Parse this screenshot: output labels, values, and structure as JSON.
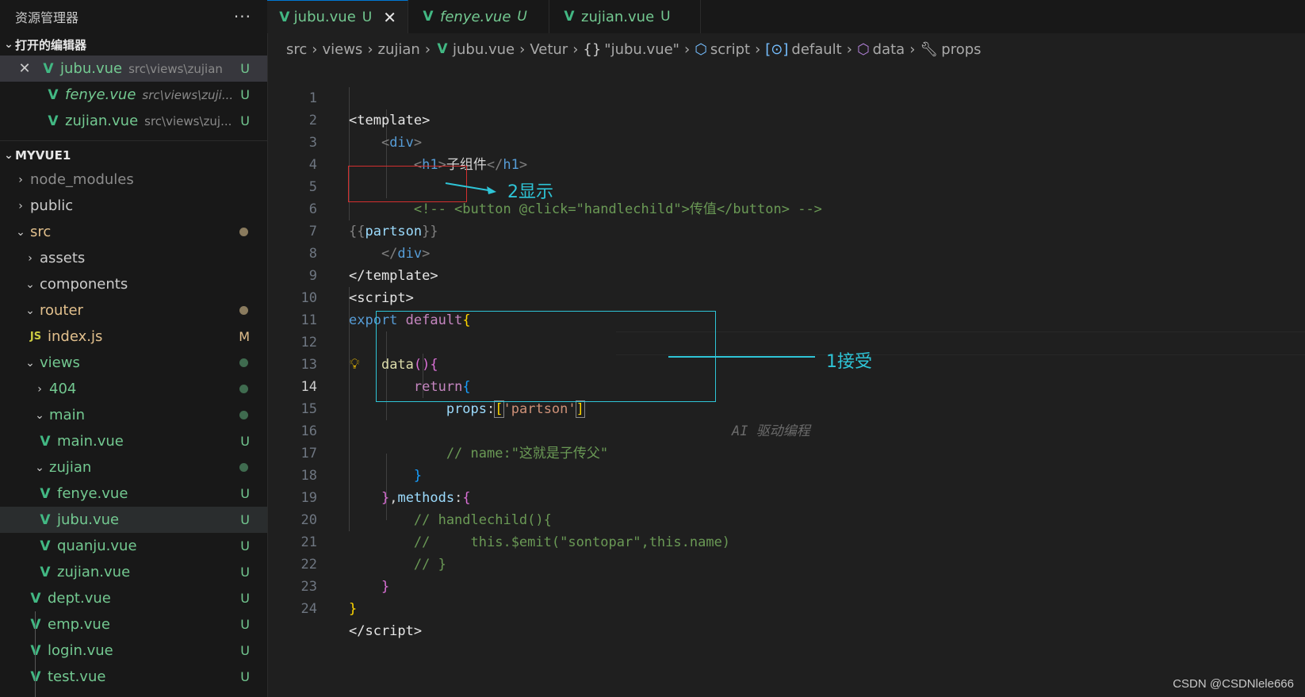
{
  "explorer": {
    "title": "资源管理器",
    "more": "···",
    "open_editors": {
      "title": "打开的编辑器",
      "items": [
        {
          "name": "jubu.vue",
          "path": "src\\views\\zujian",
          "status": "U"
        },
        {
          "name": "fenye.vue",
          "path": "src\\views\\zuji...",
          "status": "U"
        },
        {
          "name": "zujian.vue",
          "path": "src\\views\\zuj...",
          "status": "U"
        }
      ]
    },
    "project": {
      "title": "MYVUE1",
      "tree": [
        {
          "label": "node_modules"
        },
        {
          "label": "public"
        },
        {
          "label": "src"
        },
        {
          "label": "assets"
        },
        {
          "label": "components"
        },
        {
          "label": "router"
        },
        {
          "label": "index.js",
          "status": "M"
        },
        {
          "label": "views"
        },
        {
          "label": "404"
        },
        {
          "label": "main"
        },
        {
          "label": "main.vue",
          "status": "U"
        },
        {
          "label": "zujian"
        },
        {
          "label": "fenye.vue",
          "status": "U"
        },
        {
          "label": "jubu.vue",
          "status": "U"
        },
        {
          "label": "quanju.vue",
          "status": "U"
        },
        {
          "label": "zujian.vue",
          "status": "U"
        },
        {
          "label": "dept.vue",
          "status": "U"
        },
        {
          "label": "emp.vue",
          "status": "U"
        },
        {
          "label": "login.vue",
          "status": "U"
        },
        {
          "label": "test.vue",
          "status": "U"
        }
      ]
    }
  },
  "tabs": [
    {
      "name": "jubu.vue",
      "status": "U",
      "close": "✕"
    },
    {
      "name": "fenye.vue",
      "status": "U"
    },
    {
      "name": "zujian.vue",
      "status": "U"
    }
  ],
  "breadcrumb": {
    "items": [
      "src",
      "views",
      "zujian",
      "jubu.vue",
      "Vetur",
      "\"jubu.vue\"",
      "script",
      "default",
      "data",
      "props"
    ]
  },
  "code": {
    "line_numbers": [
      "1",
      "2",
      "3",
      "4",
      "5",
      "6",
      "7",
      "8",
      "9",
      "10",
      "11",
      "12",
      "13",
      "14",
      "15",
      "16",
      "17",
      "18",
      "19",
      "20",
      "21",
      "22",
      "23",
      "24"
    ],
    "ghost_text": "AI 驱动编程"
  },
  "annotations": {
    "display": "2显示",
    "receive": "1接受"
  },
  "watermark": "CSDN @CSDNlele666",
  "colors": {
    "vue_green": "#42b883",
    "untracked": "#73c991",
    "modified": "#e2c08d",
    "annotation_cyan": "#2ec4d6",
    "annotation_red": "#d32f2f"
  }
}
